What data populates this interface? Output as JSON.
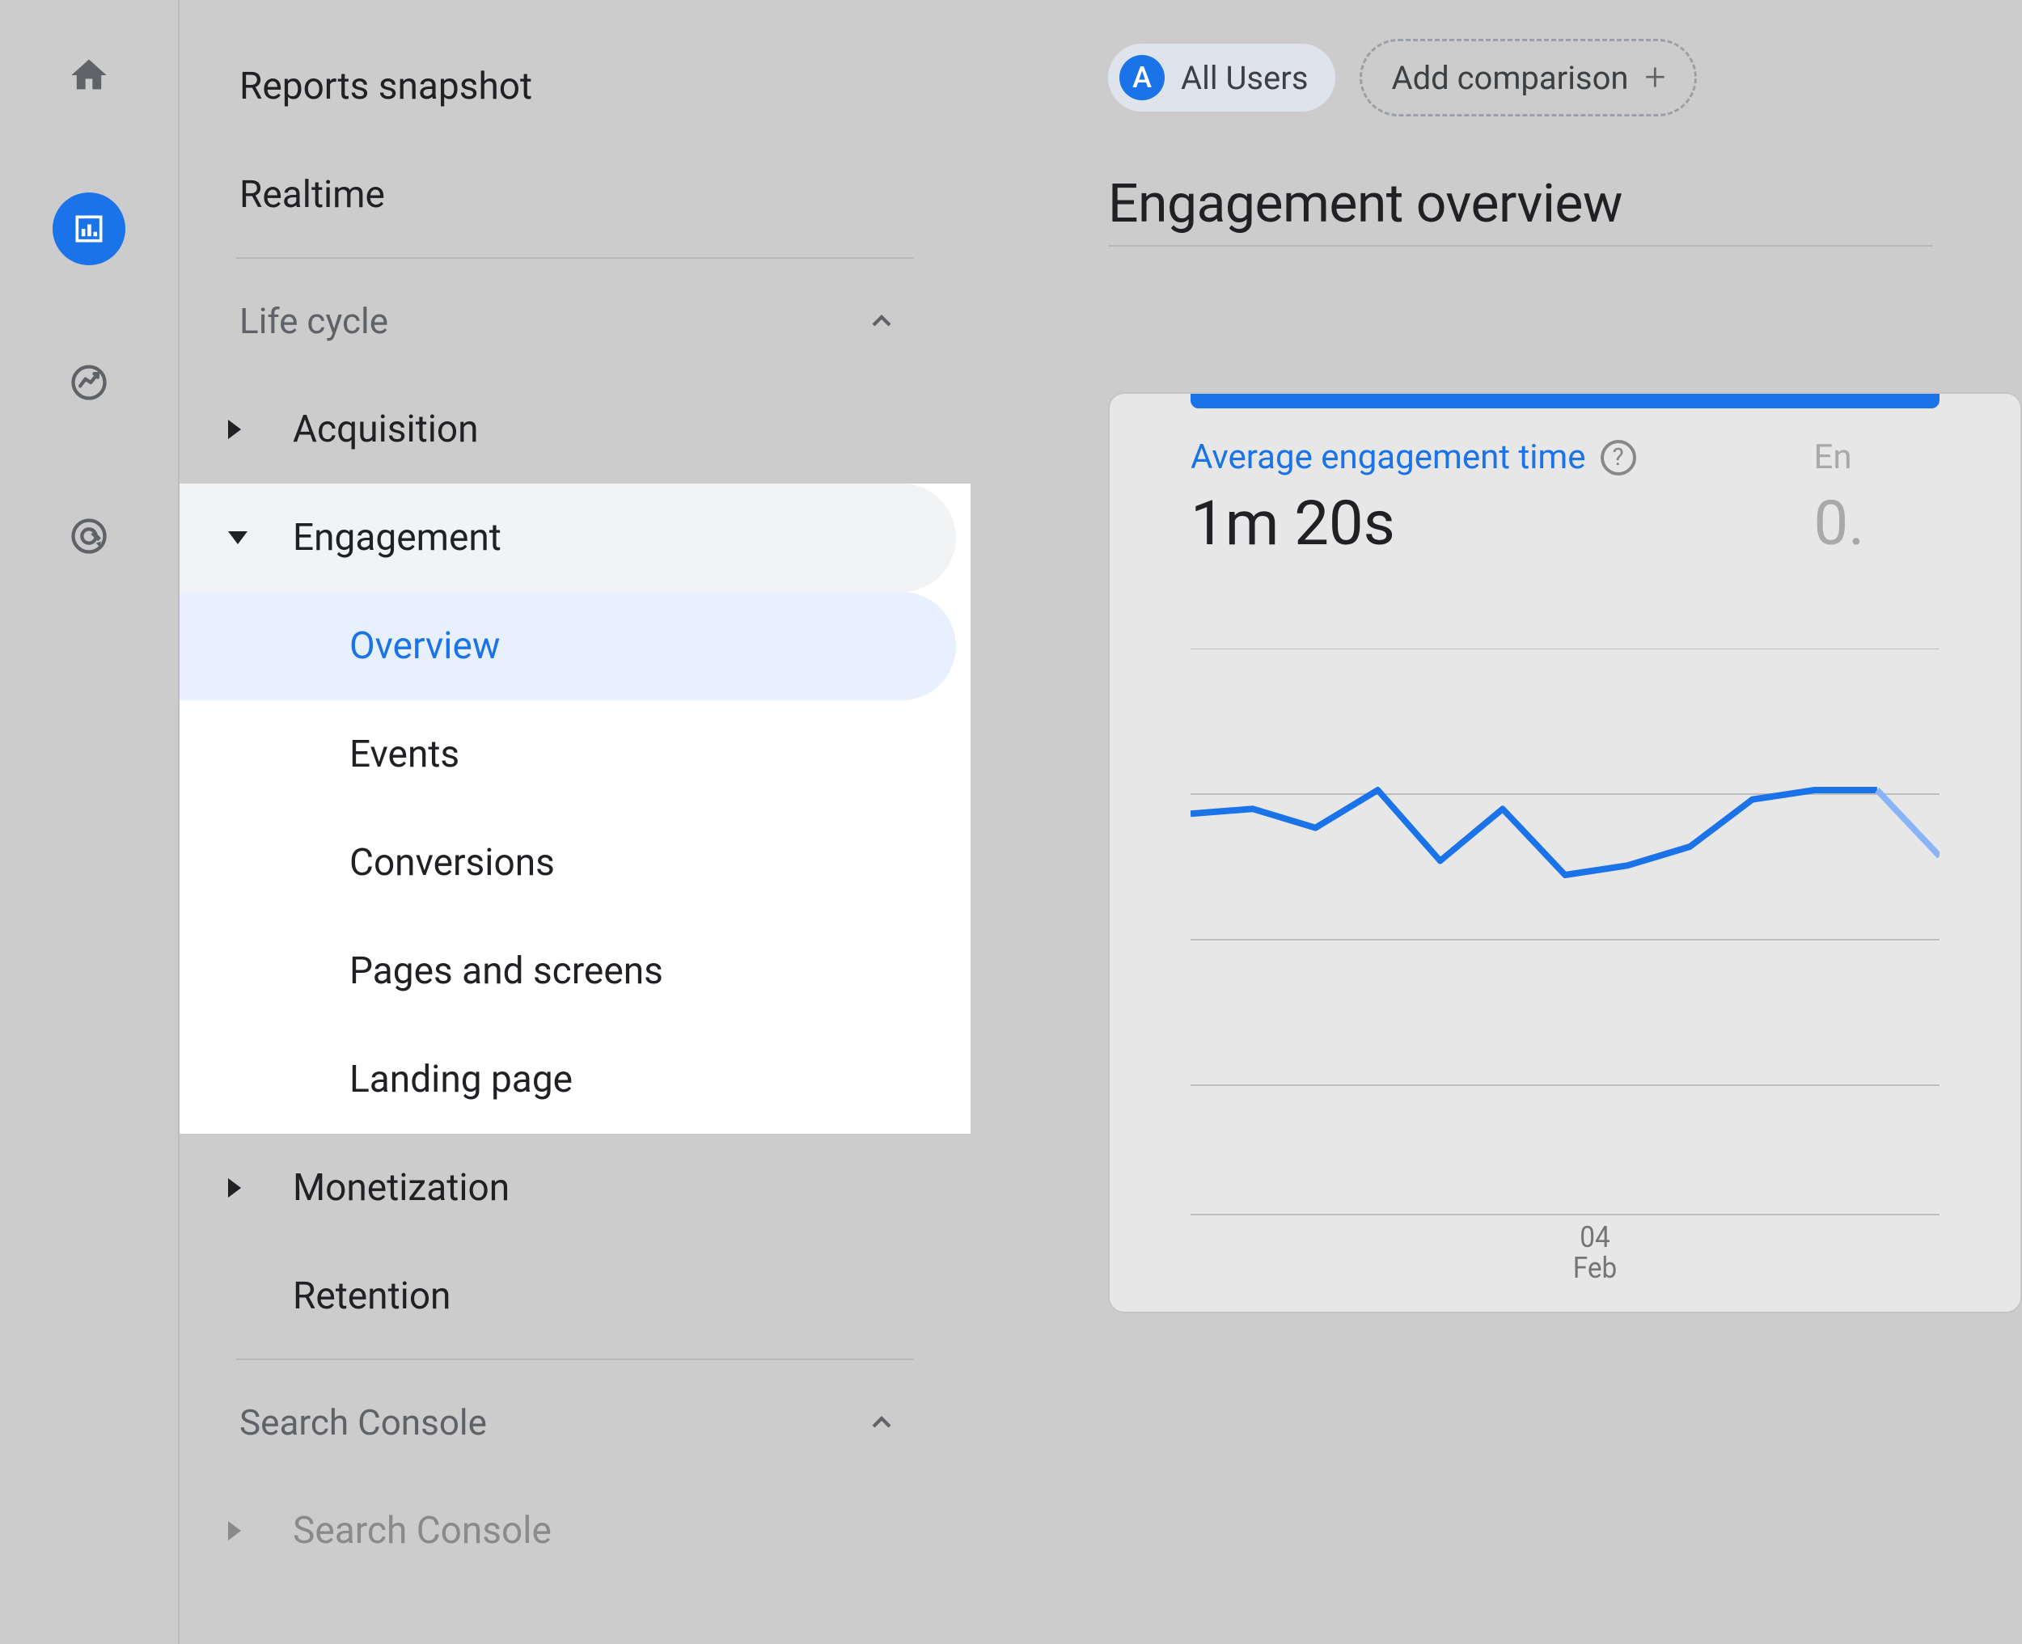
{
  "nav": {
    "reports_snapshot": "Reports snapshot",
    "realtime": "Realtime",
    "life_cycle": "Life cycle",
    "acquisition": "Acquisition",
    "engagement": "Engagement",
    "engagement_items": {
      "overview": "Overview",
      "events": "Events",
      "conversions": "Conversions",
      "pages_screens": "Pages and screens",
      "landing_page": "Landing page"
    },
    "monetization": "Monetization",
    "retention": "Retention",
    "search_console_section": "Search Console",
    "search_console": "Search Console"
  },
  "filters": {
    "chip_badge": "A",
    "chip_label": "All Users",
    "add_comparison": "Add comparison"
  },
  "page": {
    "title": "Engagement overview"
  },
  "metrics": {
    "avg_engagement_label": "Average engagement time",
    "avg_engagement_value": "1m 20s",
    "second_label_partial": "En",
    "second_value_partial": "0."
  },
  "chart_data": {
    "type": "line",
    "title": "Average engagement time",
    "xlabel": "",
    "ylabel": "",
    "ylim": [
      0,
      120
    ],
    "x_tick_label": "04",
    "x_tick_sublabel": "Feb",
    "series": [
      {
        "name": "Average engagement time",
        "x_index": [
          0,
          1,
          2,
          3,
          4,
          5,
          6,
          7,
          8,
          9,
          10,
          11,
          12
        ],
        "values": [
          85,
          86,
          82,
          90,
          75,
          86,
          72,
          74,
          78,
          88,
          90,
          90,
          76
        ]
      }
    ]
  }
}
